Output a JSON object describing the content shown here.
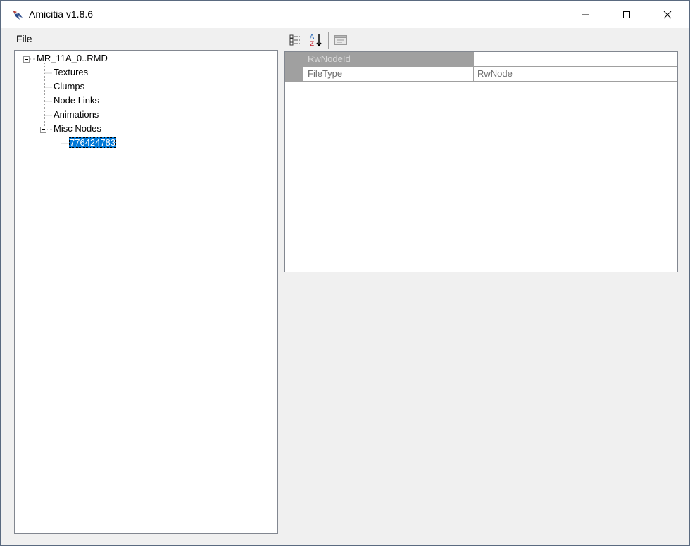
{
  "window": {
    "title": "Amicitia v1.8.6"
  },
  "menu": {
    "file_label": "File"
  },
  "tree": {
    "root": "MR_11A_0..RMD",
    "children": [
      "Textures",
      "Clumps",
      "Node Links",
      "Animations"
    ],
    "misc_nodes": {
      "label": "Misc Nodes",
      "children": [
        "776424783"
      ]
    },
    "selected": "776424783"
  },
  "toolbar": {
    "categorized_icon": "categorized-icon",
    "alphabetical_icon": "sort-az-icon",
    "property_pages_icon": "property-pages-icon"
  },
  "properties": {
    "rows": [
      {
        "name": "RwNodeId",
        "value": ""
      },
      {
        "name": "FileType",
        "value": "RwNode"
      }
    ]
  },
  "colors": {
    "selection": "#0078d7",
    "grid_line": "#a0a0a0",
    "window_bg": "#f0f0f0"
  }
}
